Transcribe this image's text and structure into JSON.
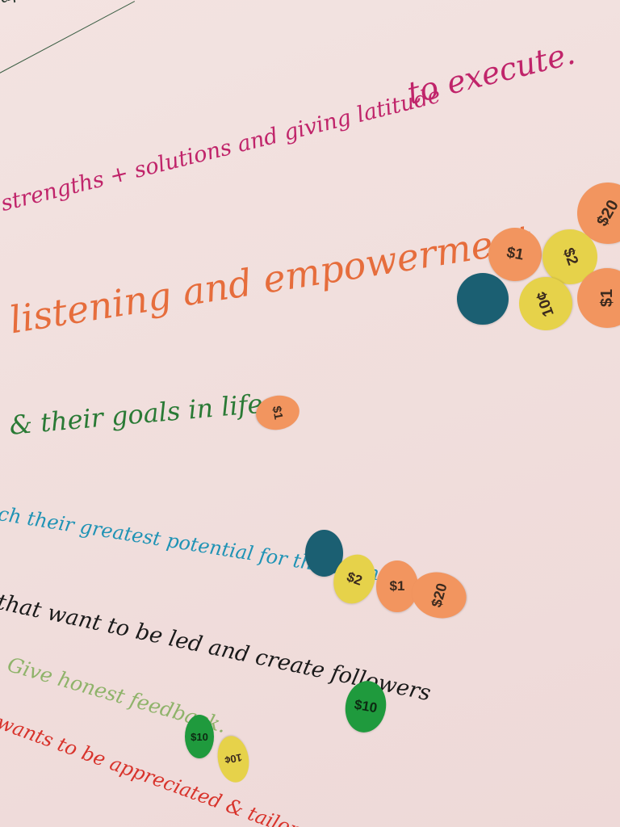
{
  "colors": {
    "paper": "#f1dfdd",
    "magenta": "#c0246a",
    "orange": "#e66d3c",
    "green": "#2a7a35",
    "teal": "#1f93b5",
    "black": "#1a1a1a",
    "lightgreen": "#8fb36a",
    "red": "#d8332b"
  },
  "notes": {
    "top_fragment": "app",
    "line1a": "to execute.",
    "line1b": "strengths + solutions and giving latitude",
    "line2": "listening and empowerment",
    "line3": "& their goals in life.",
    "line4": "ch their greatest potential for the team",
    "line5": "that want to be led and create followers",
    "line6": "Give honest feedback.",
    "line7": "wants to be appreciated & tailor the"
  },
  "stickers": [
    {
      "label": "$20",
      "color": "orange"
    },
    {
      "label": "$1",
      "color": "orange"
    },
    {
      "label": "$2",
      "color": "yellow"
    },
    {
      "label": "10¢",
      "color": "yellow"
    },
    {
      "label": "$1",
      "color": "orange"
    },
    {
      "label": "",
      "color": "blue"
    },
    {
      "label": "$1",
      "color": "orange"
    },
    {
      "label": "",
      "color": "blue"
    },
    {
      "label": "$2",
      "color": "yellow"
    },
    {
      "label": "$1",
      "color": "orange"
    },
    {
      "label": "$20",
      "color": "orange"
    },
    {
      "label": "$10",
      "color": "green"
    },
    {
      "label": "$10",
      "color": "green"
    },
    {
      "label": "10¢",
      "color": "yellow"
    }
  ]
}
